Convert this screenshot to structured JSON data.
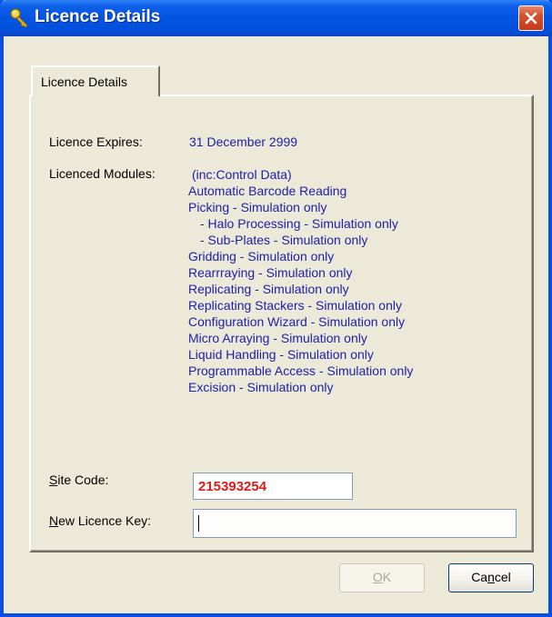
{
  "window": {
    "title": "Licence Details",
    "title_icon": "key-icon",
    "close_icon": "close-icon"
  },
  "tabs": [
    {
      "label": "Licence Details",
      "selected": true
    }
  ],
  "licence": {
    "expires_label": "Licence Expires:",
    "expires_value": "31 December 2999",
    "modules_label": "Licenced Modules:",
    "modules_header": "(inc:Control Data)",
    "modules": [
      "Automatic Barcode Reading",
      "Picking - Simulation only",
      "- Halo Processing - Simulation only",
      "- Sub-Plates - Simulation only",
      "Gridding - Simulation only",
      "Rearrraying - Simulation only",
      "Replicating - Simulation only",
      "Replicating Stackers - Simulation only",
      "Configuration Wizard -  Simulation only",
      "Micro Arraying - Simulation only",
      "Liquid Handling - Simulation only",
      "Programmable Access - Simulation only",
      "Excision - Simulation only"
    ]
  },
  "site_code": {
    "label_first": "S",
    "label_rest": "ite Code:",
    "value": "215393254"
  },
  "new_licence_key": {
    "label_first": "N",
    "label_rest": "ew Licence Key:",
    "value": ""
  },
  "buttons": {
    "ok_first": "O",
    "ok_rest": "K",
    "ok_enabled": false,
    "cancel_pre": "Ca",
    "cancel_accel": "n",
    "cancel_post": "cel"
  },
  "colors": {
    "title_bar": "#0454e3",
    "value_text": "#1f22a8",
    "site_code_text": "#e01919",
    "dialog_bg": "#ece9d8"
  }
}
